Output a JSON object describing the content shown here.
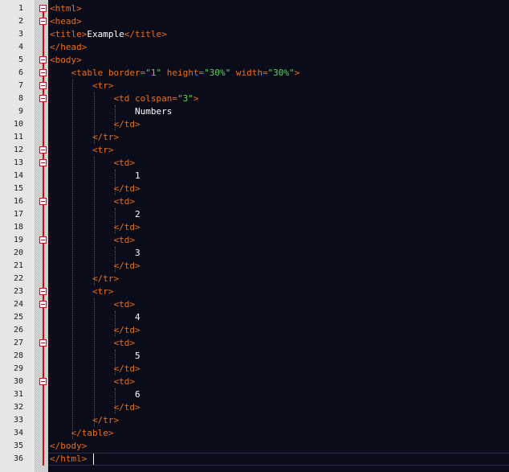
{
  "editor": {
    "lines": [
      {
        "n": "1",
        "fold": true,
        "parts": [
          {
            "t": "tag",
            "v": "<html>"
          }
        ]
      },
      {
        "n": "2",
        "fold": true,
        "parts": [
          {
            "t": "tag",
            "v": "<head>"
          }
        ]
      },
      {
        "n": "3",
        "fold": false,
        "parts": [
          {
            "t": "tag",
            "v": "<title>"
          },
          {
            "t": "txt",
            "v": "Example"
          },
          {
            "t": "tag",
            "v": "</title>"
          }
        ]
      },
      {
        "n": "4",
        "fold": false,
        "parts": [
          {
            "t": "tag",
            "v": "</head>"
          }
        ]
      },
      {
        "n": "5",
        "fold": true,
        "parts": [
          {
            "t": "tag",
            "v": "<body>"
          }
        ]
      },
      {
        "n": "6",
        "fold": true,
        "parts": [
          {
            "t": "txt",
            "v": "    "
          },
          {
            "t": "tag",
            "v": "<table "
          },
          {
            "t": "attr",
            "v": "border="
          },
          {
            "t": "val",
            "v": "\"1\""
          },
          {
            "t": "attr",
            "v": " height="
          },
          {
            "t": "val",
            "v": "\"30%\""
          },
          {
            "t": "attr",
            "v": " width="
          },
          {
            "t": "val",
            "v": "\"30%\""
          },
          {
            "t": "tag",
            "v": ">"
          }
        ]
      },
      {
        "n": "7",
        "fold": true,
        "parts": [
          {
            "t": "txt",
            "v": "        "
          },
          {
            "t": "tag",
            "v": "<tr>"
          }
        ]
      },
      {
        "n": "8",
        "fold": true,
        "parts": [
          {
            "t": "txt",
            "v": "            "
          },
          {
            "t": "tag",
            "v": "<td "
          },
          {
            "t": "attr",
            "v": "colspan="
          },
          {
            "t": "val",
            "v": "\"3\""
          },
          {
            "t": "tag",
            "v": ">"
          }
        ]
      },
      {
        "n": "9",
        "fold": false,
        "parts": [
          {
            "t": "txt",
            "v": "                Numbers"
          }
        ]
      },
      {
        "n": "10",
        "fold": false,
        "parts": [
          {
            "t": "txt",
            "v": "            "
          },
          {
            "t": "tag",
            "v": "</td>"
          }
        ]
      },
      {
        "n": "11",
        "fold": false,
        "parts": [
          {
            "t": "txt",
            "v": "        "
          },
          {
            "t": "tag",
            "v": "</tr>"
          }
        ]
      },
      {
        "n": "12",
        "fold": true,
        "parts": [
          {
            "t": "txt",
            "v": "        "
          },
          {
            "t": "tag",
            "v": "<tr>"
          }
        ]
      },
      {
        "n": "13",
        "fold": true,
        "parts": [
          {
            "t": "txt",
            "v": "            "
          },
          {
            "t": "tag",
            "v": "<td>"
          }
        ]
      },
      {
        "n": "14",
        "fold": false,
        "parts": [
          {
            "t": "txt",
            "v": "                1"
          }
        ]
      },
      {
        "n": "15",
        "fold": false,
        "parts": [
          {
            "t": "txt",
            "v": "            "
          },
          {
            "t": "tag",
            "v": "</td>"
          }
        ]
      },
      {
        "n": "16",
        "fold": true,
        "parts": [
          {
            "t": "txt",
            "v": "            "
          },
          {
            "t": "tag",
            "v": "<td>"
          }
        ]
      },
      {
        "n": "17",
        "fold": false,
        "parts": [
          {
            "t": "txt",
            "v": "                2"
          }
        ]
      },
      {
        "n": "18",
        "fold": false,
        "parts": [
          {
            "t": "txt",
            "v": "            "
          },
          {
            "t": "tag",
            "v": "</td>"
          }
        ]
      },
      {
        "n": "19",
        "fold": true,
        "parts": [
          {
            "t": "txt",
            "v": "            "
          },
          {
            "t": "tag",
            "v": "<td>"
          }
        ]
      },
      {
        "n": "20",
        "fold": false,
        "parts": [
          {
            "t": "txt",
            "v": "                3"
          }
        ]
      },
      {
        "n": "21",
        "fold": false,
        "parts": [
          {
            "t": "txt",
            "v": "            "
          },
          {
            "t": "tag",
            "v": "</td>"
          }
        ]
      },
      {
        "n": "22",
        "fold": false,
        "parts": [
          {
            "t": "txt",
            "v": "        "
          },
          {
            "t": "tag",
            "v": "</tr>"
          }
        ]
      },
      {
        "n": "23",
        "fold": true,
        "parts": [
          {
            "t": "txt",
            "v": "        "
          },
          {
            "t": "tag",
            "v": "<tr>"
          }
        ]
      },
      {
        "n": "24",
        "fold": true,
        "parts": [
          {
            "t": "txt",
            "v": "            "
          },
          {
            "t": "tag",
            "v": "<td>"
          }
        ]
      },
      {
        "n": "25",
        "fold": false,
        "parts": [
          {
            "t": "txt",
            "v": "                4"
          }
        ]
      },
      {
        "n": "26",
        "fold": false,
        "parts": [
          {
            "t": "txt",
            "v": "            "
          },
          {
            "t": "tag",
            "v": "</td>"
          }
        ]
      },
      {
        "n": "27",
        "fold": true,
        "parts": [
          {
            "t": "txt",
            "v": "            "
          },
          {
            "t": "tag",
            "v": "<td>"
          }
        ]
      },
      {
        "n": "28",
        "fold": false,
        "parts": [
          {
            "t": "txt",
            "v": "                5"
          }
        ]
      },
      {
        "n": "29",
        "fold": false,
        "parts": [
          {
            "t": "txt",
            "v": "            "
          },
          {
            "t": "tag",
            "v": "</td>"
          }
        ]
      },
      {
        "n": "30",
        "fold": true,
        "parts": [
          {
            "t": "txt",
            "v": "            "
          },
          {
            "t": "tag",
            "v": "<td>"
          }
        ]
      },
      {
        "n": "31",
        "fold": false,
        "parts": [
          {
            "t": "txt",
            "v": "                6"
          }
        ]
      },
      {
        "n": "32",
        "fold": false,
        "parts": [
          {
            "t": "txt",
            "v": "            "
          },
          {
            "t": "tag",
            "v": "</td>"
          }
        ]
      },
      {
        "n": "33",
        "fold": false,
        "parts": [
          {
            "t": "txt",
            "v": "        "
          },
          {
            "t": "tag",
            "v": "</tr>"
          }
        ]
      },
      {
        "n": "34",
        "fold": false,
        "parts": [
          {
            "t": "txt",
            "v": "    "
          },
          {
            "t": "tag",
            "v": "</table>"
          }
        ]
      },
      {
        "n": "35",
        "fold": false,
        "parts": [
          {
            "t": "tag",
            "v": "</body>"
          }
        ]
      },
      {
        "n": "36",
        "fold": false,
        "parts": [
          {
            "t": "tag",
            "v": "</html>"
          }
        ]
      }
    ]
  },
  "colors": {
    "background": "#0b0c1a",
    "tag": "#e8701a",
    "attribute_value": "#5fd35f",
    "text": "#ffffff",
    "gutter": "#e6e6e6",
    "fold_marker": "#d01010"
  },
  "icons": {
    "fold": "collapse-minus-icon"
  }
}
